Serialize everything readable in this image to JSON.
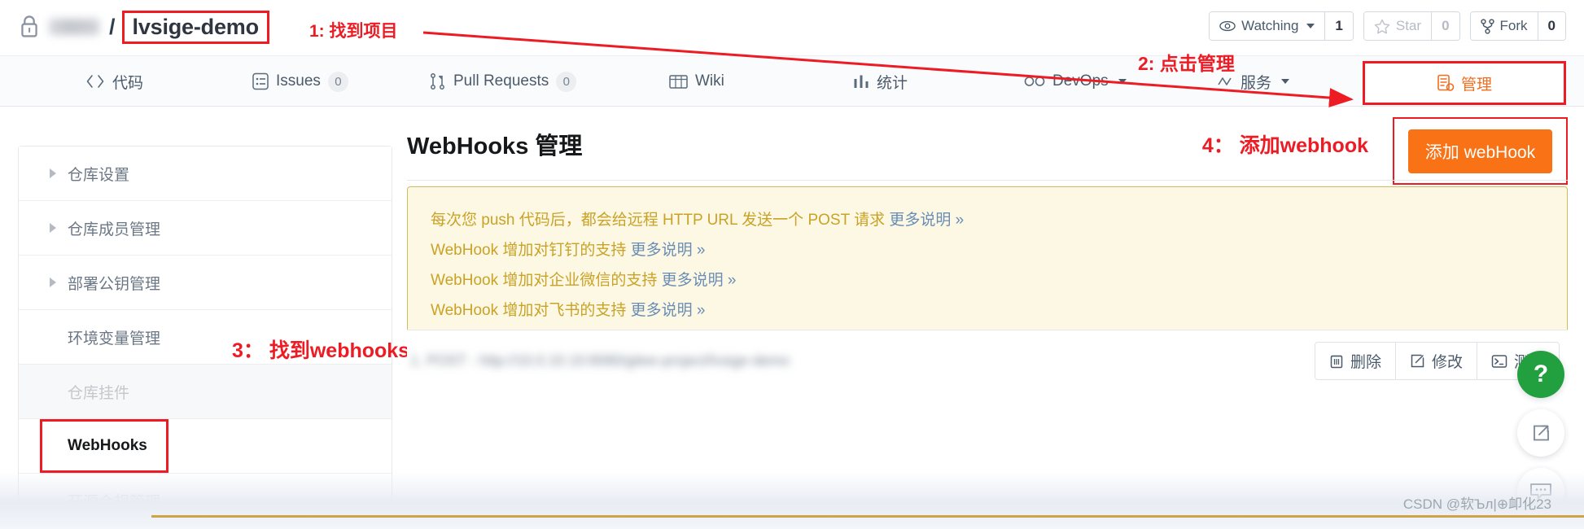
{
  "header": {
    "lock_icon": "lock-icon",
    "owner_redacted": "",
    "separator": "/",
    "repo_name": "lvsige-demo",
    "actions": [
      {
        "icon": "eye-icon",
        "label": "Watching",
        "count": "1",
        "has_caret": true,
        "muted": false
      },
      {
        "icon": "star-icon",
        "label": "Star",
        "count": "0",
        "has_caret": false,
        "muted": true
      },
      {
        "icon": "fork-icon",
        "label": "Fork",
        "count": "0",
        "has_caret": false,
        "muted": false
      }
    ]
  },
  "nav": {
    "items": [
      {
        "icon": "code-icon",
        "label": "代码",
        "badge": ""
      },
      {
        "icon": "issues-icon",
        "label": "Issues",
        "badge": "0"
      },
      {
        "icon": "pull-request-icon",
        "label": "Pull Requests",
        "badge": "0"
      },
      {
        "icon": "wiki-icon",
        "label": "Wiki",
        "badge": ""
      },
      {
        "icon": "stats-icon",
        "label": "统计",
        "badge": ""
      },
      {
        "icon": "devops-icon",
        "label": "DevOps",
        "badge": "",
        "caret": true
      },
      {
        "icon": "service-icon",
        "label": "服务",
        "badge": "",
        "caret": true
      }
    ],
    "manage": {
      "icon": "manage-icon",
      "label": "管理"
    }
  },
  "sidebar": {
    "items": [
      {
        "label": "仓库设置",
        "expandable": true,
        "state": "normal"
      },
      {
        "label": "仓库成员管理",
        "expandable": true,
        "state": "normal"
      },
      {
        "label": "部署公钥管理",
        "expandable": true,
        "state": "normal"
      },
      {
        "label": "环境变量管理",
        "expandable": false,
        "state": "normal"
      },
      {
        "label": "仓库挂件",
        "expandable": false,
        "state": "disabled"
      },
      {
        "label": "WebHooks",
        "expandable": false,
        "state": "active"
      },
      {
        "label": "开源合规管理",
        "expandable": false,
        "state": "faded"
      }
    ]
  },
  "main": {
    "page_title": "WebHooks 管理",
    "add_button_label": "添加 webHook",
    "alert_lines": [
      {
        "text": "每次您 push 代码后，都会给远程 HTTP URL 发送一个 POST 请求 ",
        "link": "更多说明 »"
      },
      {
        "text": "WebHook 增加对钉钉的支持 ",
        "link": "更多说明 »"
      },
      {
        "text": "WebHook 增加对企业微信的支持 ",
        "link": "更多说明 »"
      },
      {
        "text": "WebHook 增加对飞书的支持 ",
        "link": "更多说明 »"
      }
    ],
    "hook_row": {
      "url_redacted": "1. POST - http://10.0.10.10:8080/gitee-project/lvsige-demo",
      "actions": [
        {
          "icon": "trash-icon",
          "label": "删除"
        },
        {
          "icon": "edit-icon",
          "label": "修改"
        },
        {
          "icon": "terminal-icon",
          "label": "测试"
        }
      ]
    }
  },
  "fabs": [
    {
      "icon": "help-icon",
      "glyph": "?"
    },
    {
      "icon": "share-icon",
      "glyph": ""
    },
    {
      "icon": "feedback-icon",
      "glyph": ""
    }
  ],
  "annotations": [
    {
      "id": "anno-1",
      "text": "1: 找到项目"
    },
    {
      "id": "anno-2",
      "text": "2: 点击管理"
    },
    {
      "id": "anno-3",
      "text": "3： 找到webhooks"
    },
    {
      "id": "anno-4",
      "text": "4： 添加webhook"
    }
  ],
  "watermark": {
    "text": "CSDN @软Ъл|⊕卹化23"
  },
  "colors": {
    "accent_orange": "#f97316",
    "annotation_red": "#ed1c24",
    "alert_bg": "#fcf8e3",
    "alert_border": "#d4b95e",
    "alert_text": "#c9a227",
    "link_blue": "#6a8db5",
    "nav_bg": "#fafbfc",
    "help_green": "#22a03f"
  }
}
